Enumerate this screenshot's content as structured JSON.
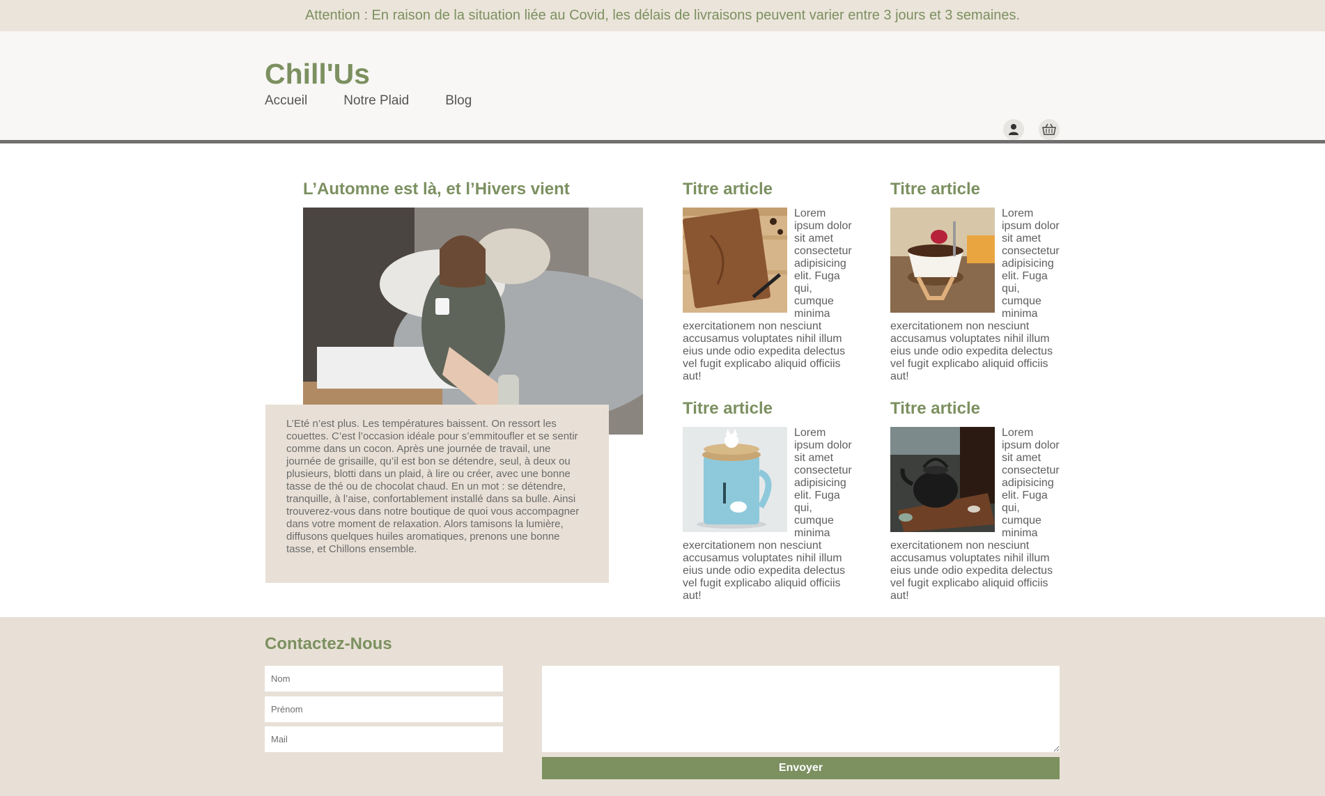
{
  "banner": {
    "text": "Attention : En raison de la situation liée au Covid, les délais de livraisons peuvent varier entre 3 jours et 3 semaines."
  },
  "header": {
    "logo": "Chill'Us",
    "nav": [
      {
        "label": "Accueil"
      },
      {
        "label": "Notre Plaid"
      },
      {
        "label": "Blog"
      }
    ],
    "icons": [
      "user-icon",
      "basket-icon"
    ]
  },
  "feature": {
    "title": "L’Automne est là, et l’Hivers vient",
    "text": "L’Eté n’est plus. Les températures baissent. On ressort les couettes. C’est l’occasion idéale pour s’emmitoufler et se sentir comme dans un cocon. Après une journée de travail, une journée de grisaille, qu’il est bon se détendre, seul, à deux ou plusieurs, blotti dans un plaid, à lire ou créer, avec une bonne tasse de thé ou de chocolat chaud. En un mot : se détendre, tranquille, à l’aise, confortablement installé dans sa bulle. Ainsi trouverez-vous dans notre boutique de quoi vous accompagner dans votre moment de relaxation. Alors tamisons la lumière, diffusons quelques huiles aromatiques, prenons une bonne tasse, et Chillons ensemble."
  },
  "articles": [
    {
      "title": "Titre article",
      "text": "Lorem ipsum dolor sit amet consectetur adipisicing elit. Fuga qui, cumque minima exercitationem non nesciunt accusamus voluptates nihil illum eius unde odio expedita delectus vel fugit explicabo aliquid officiis aut!"
    },
    {
      "title": "Titre article",
      "text": "Lorem ipsum dolor sit amet consectetur adipisicing elit. Fuga qui, cumque minima exercitationem non nesciunt accusamus voluptates nihil illum eius unde odio expedita delectus vel fugit explicabo aliquid officiis aut!"
    },
    {
      "title": "Titre article",
      "text": "Lorem ipsum dolor sit amet consectetur adipisicing elit. Fuga qui, cumque minima exercitationem non nesciunt accusamus voluptates nihil illum eius unde odio expedita delectus vel fugit explicabo aliquid officiis aut!"
    },
    {
      "title": "Titre article",
      "text": "Lorem ipsum dolor sit amet consectetur adipisicing elit. Fuga qui, cumque minima exercitationem non nesciunt accusamus voluptates nihil illum eius unde odio expedita delectus vel fugit explicabo aliquid officiis aut!"
    }
  ],
  "contact": {
    "title": "Contactez-Nous",
    "nom_placeholder": "Nom",
    "prenom_placeholder": "Prénom",
    "mail_placeholder": "Mail",
    "message_value": "",
    "submit_label": "Envoyer"
  },
  "colors": {
    "accent_green": "#7c9060",
    "beige": "#e8e0d6",
    "header_bg": "#f8f7f5"
  }
}
